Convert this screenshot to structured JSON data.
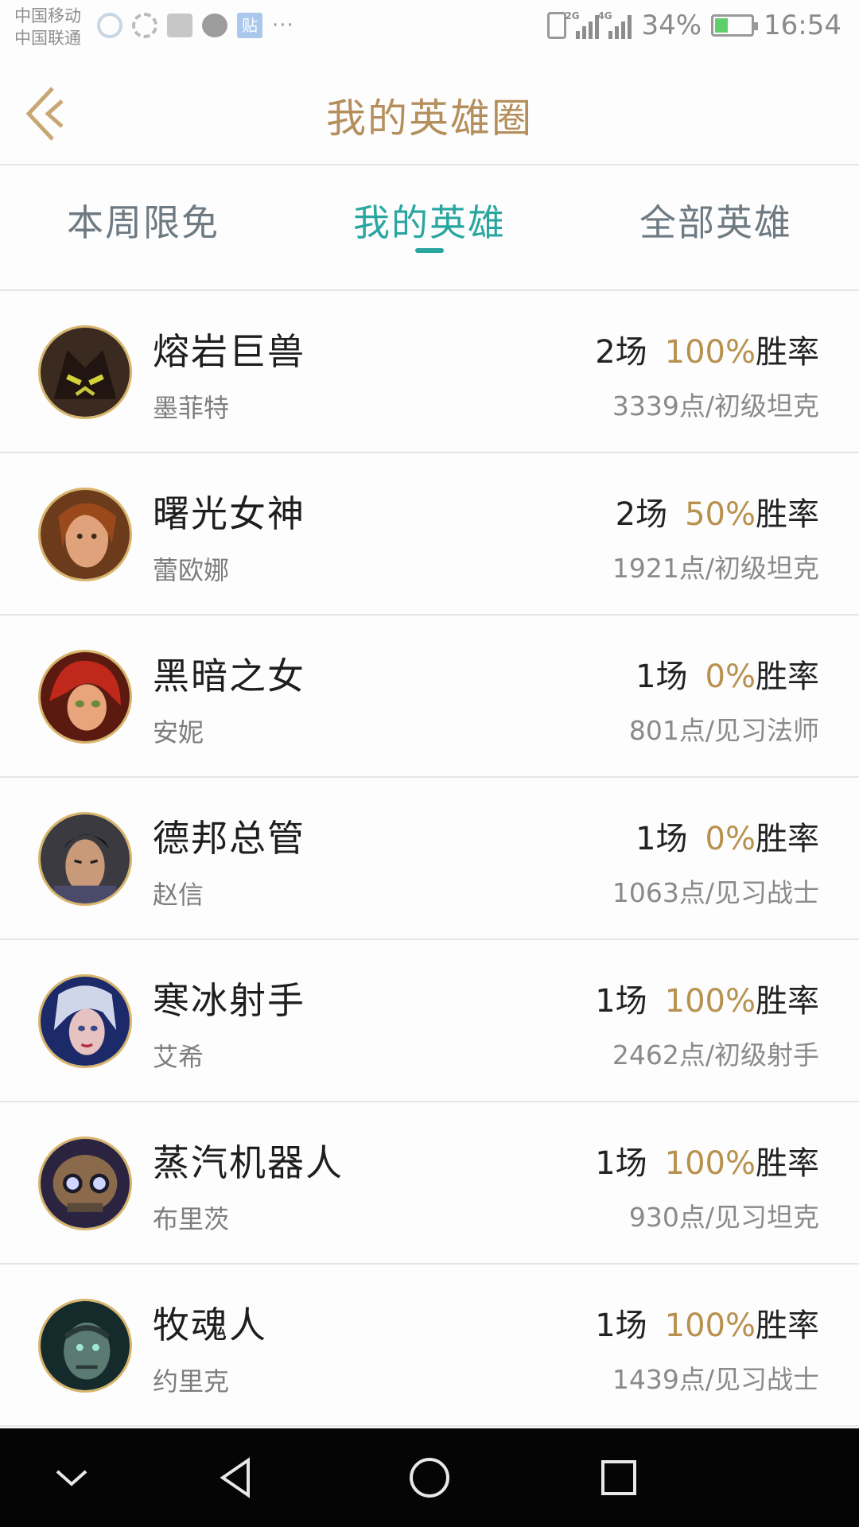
{
  "status_bar": {
    "carrier_1": "中国移动",
    "carrier_2": "中国联通",
    "app_badge": "贴",
    "more": "···",
    "net_1": "2G",
    "net_2": "4G",
    "battery": "34%",
    "battery_level": 0.34,
    "time": "16:54"
  },
  "header": {
    "title": "我的英雄圈"
  },
  "tabs": [
    {
      "label": "本周限免",
      "active": false
    },
    {
      "label": "我的英雄",
      "active": true
    },
    {
      "label": "全部英雄",
      "active": false
    }
  ],
  "heroes": [
    {
      "title": "熔岩巨兽",
      "name": "墨菲特",
      "games": "2场",
      "win_rate": "100%",
      "win_label": "胜率",
      "points": "3339点/初级坦克",
      "avatar_icon": "lava-golem-portrait"
    },
    {
      "title": "曙光女神",
      "name": "蕾欧娜",
      "games": "2场",
      "win_rate": "50%",
      "win_label": "胜率",
      "points": "1921点/初级坦克",
      "avatar_icon": "dawn-goddess-portrait"
    },
    {
      "title": "黑暗之女",
      "name": "安妮",
      "games": "1场",
      "win_rate": "0%",
      "win_label": "胜率",
      "points": "801点/见习法师",
      "avatar_icon": "dark-child-portrait"
    },
    {
      "title": "德邦总管",
      "name": "赵信",
      "games": "1场",
      "win_rate": "0%",
      "win_label": "胜率",
      "points": "1063点/见习战士",
      "avatar_icon": "seneschal-portrait"
    },
    {
      "title": "寒冰射手",
      "name": "艾希",
      "games": "1场",
      "win_rate": "100%",
      "win_label": "胜率",
      "points": "2462点/初级射手",
      "avatar_icon": "frost-archer-portrait"
    },
    {
      "title": "蒸汽机器人",
      "name": "布里茨",
      "games": "1场",
      "win_rate": "100%",
      "win_label": "胜率",
      "points": "930点/见习坦克",
      "avatar_icon": "steam-golem-portrait"
    },
    {
      "title": "牧魂人",
      "name": "约里克",
      "games": "1场",
      "win_rate": "100%",
      "win_label": "胜率",
      "points": "1439点/见习战士",
      "avatar_icon": "shepherd-of-souls-portrait"
    }
  ],
  "nav_bar": {
    "buttons": [
      "collapse-icon",
      "back-triangle-icon",
      "home-circle-icon",
      "recents-square-icon"
    ]
  },
  "colors": {
    "accent_gold": "#b48f5c",
    "tab_active": "#2aa6a0",
    "win_rate": "#b8914f"
  }
}
